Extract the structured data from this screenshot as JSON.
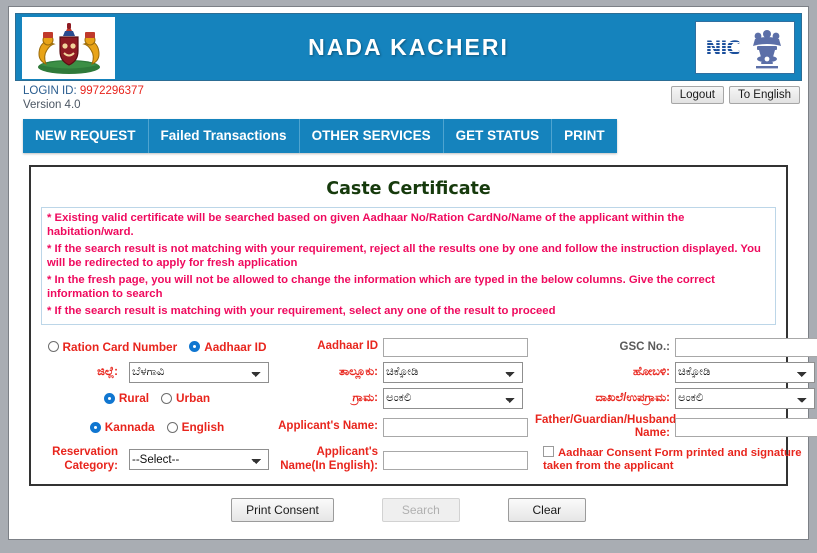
{
  "header": {
    "title": "NADA KACHERI",
    "emblem_alt": "karnataka-state-emblem",
    "nic_text": "NIC",
    "nic_alt": "national-informatics-centre-logo"
  },
  "loginbar": {
    "login_label": "LOGIN ID:",
    "login_id": "9972296377",
    "version": "Version 4.0",
    "logout_label": "Logout",
    "language_toggle_label": "To English"
  },
  "nav": {
    "tabs": [
      {
        "label": "NEW REQUEST"
      },
      {
        "label": "Failed Transactions"
      },
      {
        "label": "OTHER SERVICES"
      },
      {
        "label": "GET STATUS"
      },
      {
        "label": "PRINT"
      }
    ]
  },
  "card": {
    "title": "Caste Certificate",
    "notices": [
      "* Existing valid certificate will be searched based on given Aadhaar No/Ration CardNo/Name of the applicant within the habitation/ward.",
      "* If the search result is not matching with your requirement, reject all the results one by one and follow the instruction displayed. You will be redirected to apply for fresh application",
      "* In the fresh page, you will not be allowed to change the information which are typed in the below columns. Give the correct information to search",
      "* If the search result is matching with your requirement, select any one of the result to proceed"
    ]
  },
  "form": {
    "id_type": {
      "ration_label": "Ration Card Number",
      "aadhaar_label": "Aadhaar ID",
      "selected": "Aadhaar ID"
    },
    "aadhaar_id": {
      "label": "Aadhaar ID",
      "value": "",
      "placeholder": ""
    },
    "gsc_no": {
      "label": "GSC No.:",
      "value": "",
      "placeholder": ""
    },
    "district": {
      "label": "ಜಿಲ್ಲೆ:",
      "value": "ಬೆಳಗಾವಿ"
    },
    "taluk": {
      "label": "ತಾಲ್ಲೂಕು:",
      "value": "ಚಿಕ್ಕೋಡಿ"
    },
    "hobli": {
      "label": "ಹೋಬಳಿ:",
      "value": "ಚಿಕ್ಕೋಡಿ"
    },
    "area_type": {
      "rural_label": "Rural",
      "urban_label": "Urban",
      "selected": "Rural"
    },
    "village": {
      "label": "ಗ್ರಾಮ:",
      "value": "ಅಂಕಲಿ"
    },
    "hamlet": {
      "label": "ದಾಖಲೆ/ಉಪಗ್ರಾಮ:",
      "value": "ಅಂಕಲಿ"
    },
    "language": {
      "kannada_label": "Kannada",
      "english_label": "English",
      "selected": "Kannada"
    },
    "applicant_name": {
      "label": "Applicant's Name:",
      "value": "",
      "placeholder": ""
    },
    "father_name": {
      "label": "Father/Guardian/Husband Name:",
      "value": "",
      "placeholder": ""
    },
    "reservation_category": {
      "label": "Reservation Category:",
      "value": "--Select--"
    },
    "applicant_name_english": {
      "label": "Applicant's Name(In English):",
      "value": "",
      "placeholder": ""
    },
    "consent": {
      "label": "Aadhaar Consent Form printed and signature taken from the applicant",
      "checked": false
    }
  },
  "actions": {
    "print_consent_label": "Print Consent",
    "search_label": "Search",
    "search_disabled": true,
    "clear_label": "Clear"
  },
  "colors": {
    "banner_blue": "#1583bd",
    "label_red": "#e8251d",
    "notice_pink": "#ef0a5e",
    "title_green": "#163a0c",
    "page_gray": "#a9adb3"
  }
}
